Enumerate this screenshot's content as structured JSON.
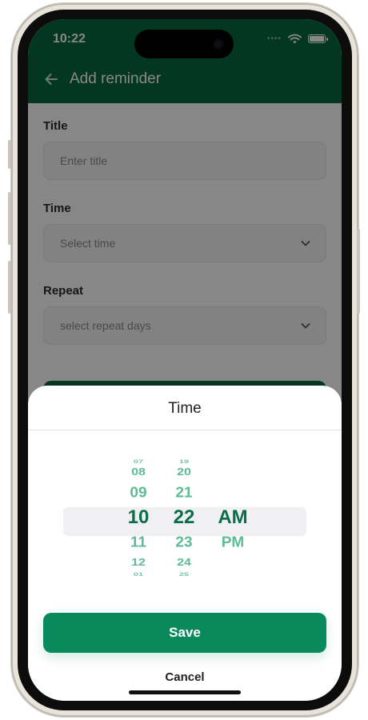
{
  "status_bar": {
    "time": "10:22"
  },
  "header": {
    "title": "Add reminder"
  },
  "form": {
    "title_label": "Title",
    "title_placeholder": "Enter title",
    "time_label": "Time",
    "time_placeholder": "Select time",
    "repeat_label": "Repeat",
    "repeat_placeholder": "select repeat days"
  },
  "sheet": {
    "title": "Time",
    "save_label": "Save",
    "cancel_label": "Cancel"
  },
  "picker": {
    "hours": [
      "07",
      "08",
      "09",
      "10",
      "11",
      "12",
      "01"
    ],
    "minutes": [
      "19",
      "20",
      "21",
      "22",
      "23",
      "24",
      "25"
    ],
    "periods": [
      "AM",
      "PM"
    ],
    "selected": {
      "hour": "10",
      "minute": "22",
      "period": "AM"
    }
  },
  "colors": {
    "brand_green": "#08683f",
    "button_green": "#0a8a5c",
    "picker_faded": "#5fba96",
    "picker_selected": "#0a6d49"
  }
}
